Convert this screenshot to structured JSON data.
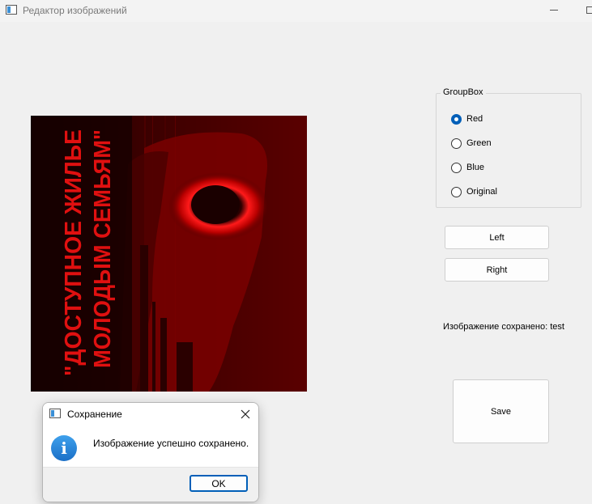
{
  "window": {
    "title": "Редактор изображений"
  },
  "poster": {
    "line1": "\"ДОСТУПНОЕ ЖИЛЬЕ",
    "line2": "МОЛОДЫМ СЕМЬЯМ\""
  },
  "groupbox": {
    "title": "GroupBox",
    "options": [
      {
        "label": "Red",
        "checked": true
      },
      {
        "label": "Green",
        "checked": false
      },
      {
        "label": "Blue",
        "checked": false
      },
      {
        "label": "Original",
        "checked": false
      }
    ]
  },
  "buttons": {
    "left": "Left",
    "right": "Right",
    "save": "Save"
  },
  "status": "Изображение сохранено: test",
  "dialog": {
    "title": "Сохранение",
    "message": "Изображение успешно сохранено.",
    "ok": "OK",
    "icon": "info-icon"
  },
  "colors": {
    "accent": "#005fb8",
    "image_tint": "#c00000"
  }
}
